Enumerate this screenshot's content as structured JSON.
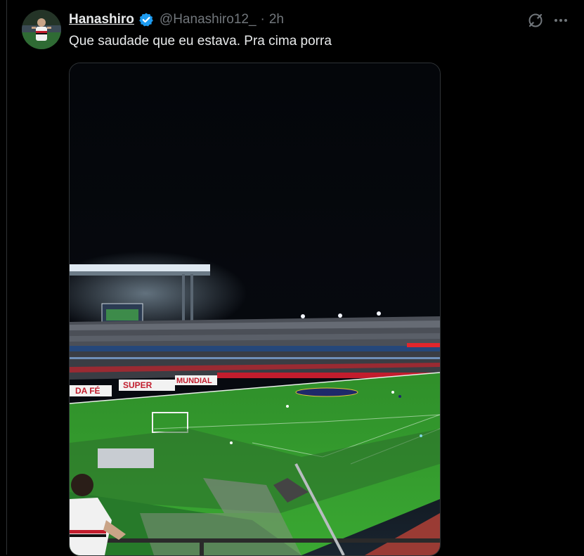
{
  "tweet": {
    "display_name": "Hanashiro",
    "handle": "@Hanashiro12_",
    "separator": "·",
    "time": "2h",
    "text": "Que saudade que eu estava. Pra cima porra"
  },
  "icons": {
    "verified": "verified-badge-icon",
    "grok": "grok-icon",
    "more": "more-options-icon"
  },
  "media": {
    "banners": [
      "SUPER",
      "MUNDIAL",
      "DA FÉ"
    ]
  },
  "colors": {
    "background": "#000000",
    "text_primary": "#e7e9ea",
    "text_secondary": "#71767b",
    "verified_blue": "#1d9bf0",
    "border": "#2f3336"
  }
}
